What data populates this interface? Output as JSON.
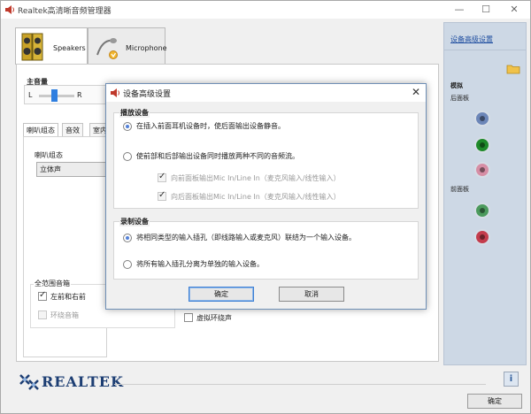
{
  "window": {
    "title": "Realtek高清晰音频管理器"
  },
  "device_tabs": [
    {
      "label": "Speakers"
    },
    {
      "label": "Microphone"
    }
  ],
  "volume": {
    "label": "主音量",
    "left": "L",
    "right": "R"
  },
  "sub_tabs": [
    "喇叭组态",
    "音效",
    "室内"
  ],
  "speaker_config": {
    "label": "喇叭组态",
    "selected": "立体声"
  },
  "full_range": {
    "label": "全范围音箱",
    "items": [
      {
        "label": "左前和右前",
        "checked": true
      },
      {
        "label": "环绕音箱",
        "checked": false
      }
    ]
  },
  "virtual_surround": {
    "label": "虚拟环绕声",
    "checked": false
  },
  "right_panel": {
    "advanced_link": "设备高级设置",
    "analog_label": "模拟",
    "back_panel_label": "后面板",
    "front_panel_label": "前面板",
    "back_jacks": [
      "#6c86b8",
      "#1f8a2a",
      "#d68ea5"
    ],
    "front_jacks": [
      "#4c9a5d",
      "#c33c4c"
    ]
  },
  "brand": {
    "name": "REALTEK"
  },
  "main_ok": "确定",
  "dialog": {
    "title": "设备高级设置",
    "playback": {
      "title": "播放设备",
      "options": [
        {
          "label": "在插入前面耳机设备时，使后面输出设备静音。",
          "selected": true
        },
        {
          "label": "使前部和后部输出设备同时播放两种不同的音频流。",
          "selected": false
        }
      ],
      "sub_options": [
        {
          "label": "向前面板输出Mic In/Line In（麦克风输入/线性输入）",
          "checked": true
        },
        {
          "label": "向后面板输出Mic In/Line In（麦克风输入/线性输入）",
          "checked": true
        }
      ]
    },
    "recording": {
      "title": "录制设备",
      "options": [
        {
          "label": "将相同类型的输入插孔（即线路输入或麦克风）联结为一个输入设备。",
          "selected": true
        },
        {
          "label": "将所有输入插孔分离为单独的输入设备。",
          "selected": false
        }
      ]
    },
    "ok": "确定",
    "cancel": "取消"
  },
  "colors": {
    "accent": "#3c7fd4",
    "link": "#1f4ea0",
    "brand": "#1d3e73"
  }
}
